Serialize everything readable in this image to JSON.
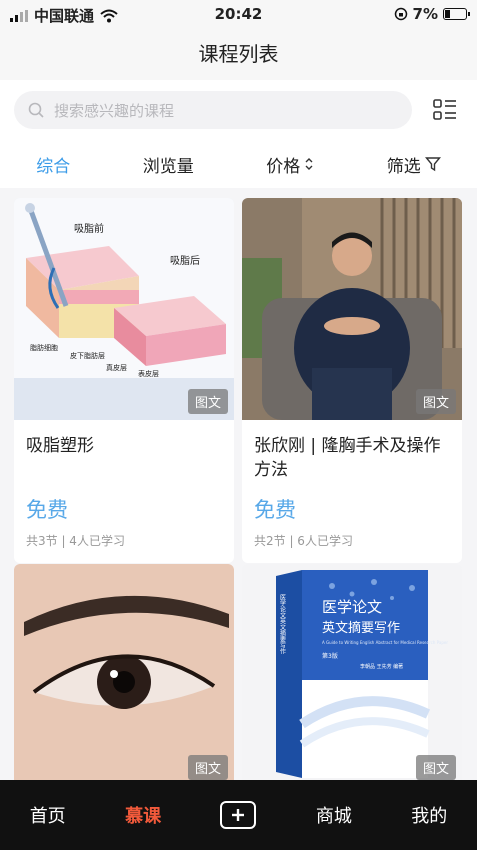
{
  "status": {
    "carrier": "中国联通",
    "time": "20:42",
    "battery": "7%"
  },
  "header": {
    "title": "课程列表"
  },
  "search": {
    "placeholder": "搜索感兴趣的课程"
  },
  "filters": [
    {
      "label": "综合",
      "active": true
    },
    {
      "label": "浏览量"
    },
    {
      "label": "价格"
    },
    {
      "label": "筛选"
    }
  ],
  "cards": [
    {
      "title": "吸脂塑形",
      "badge": "图文",
      "price": "免费",
      "meta": "共3节 | 4人已学习",
      "image_labels": {
        "before": "吸脂前",
        "after": "吸脂后",
        "l1": "脂肪细胞",
        "l2": "皮下脂肪层",
        "l3": "真皮层",
        "l4": "表皮层"
      }
    },
    {
      "title": "张欣刚 | 隆胸手术及操作方法",
      "badge": "图文",
      "price": "免费",
      "meta": "共2节 | 6人已学习"
    },
    {
      "title": "",
      "badge": "图文"
    },
    {
      "title": "",
      "badge": "图文",
      "book": {
        "title1": "医学论文",
        "title2": "英文摘要写作",
        "spine": "医学论文英文摘要写作",
        "en": "A Guide to Writing English Abstract for Medical Research Paper",
        "edition": "第3版",
        "authors": "李朝品  王先芳  编著"
      }
    }
  ],
  "tabbar": [
    {
      "label": "首页"
    },
    {
      "label": "慕课",
      "active": true
    },
    {
      "label": ""
    },
    {
      "label": "商城"
    },
    {
      "label": "我的"
    }
  ],
  "colors": {
    "accent": "#3a9be8",
    "price": "#58a8e8",
    "tab_active": "#f25a3b"
  }
}
